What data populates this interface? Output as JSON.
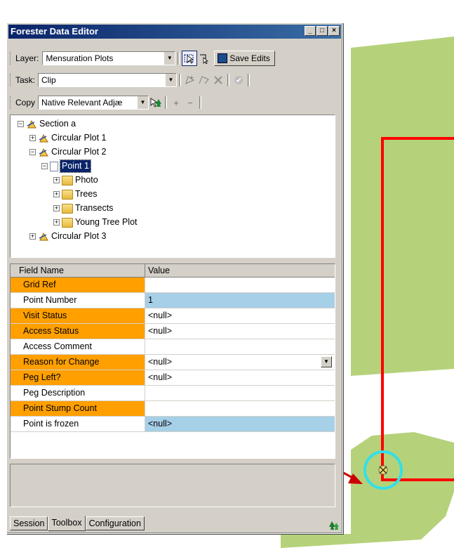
{
  "window": {
    "title": "Forester Data Editor",
    "buttons": [
      "_",
      "□",
      "×"
    ]
  },
  "toolbar": {
    "layer_label": "Layer:",
    "layer_value": "Mensuration Plots",
    "save_label": "Save Edits",
    "task_label": "Task:",
    "task_value": "Clip",
    "copy_label": "Copy",
    "copy_value": "Native Relevant Adjæ",
    "plus_label": "+",
    "minus_label": "−"
  },
  "tree": {
    "nodes": [
      {
        "label": "Section a",
        "toggle": "−",
        "icon": "plot-icon"
      },
      {
        "label": "Circular Plot 1",
        "toggle": "+",
        "icon": "plot-icon"
      },
      {
        "label": "Circular Plot 2",
        "toggle": "−",
        "icon": "plot-icon"
      },
      {
        "label": "Point 1",
        "toggle": "−",
        "icon": "document-icon",
        "selected": true
      },
      {
        "label": "Photo",
        "toggle": "+",
        "icon": "folder-icon"
      },
      {
        "label": "Trees",
        "toggle": "+",
        "icon": "folder-icon"
      },
      {
        "label": "Transects",
        "toggle": "+",
        "icon": "folder-icon"
      },
      {
        "label": "Young Tree Plot",
        "toggle": "+",
        "icon": "folder-icon"
      },
      {
        "label": "Circular Plot 3",
        "toggle": "+",
        "icon": "plot-icon"
      }
    ]
  },
  "grid": {
    "headers": [
      "Field Name",
      "Value"
    ],
    "rows": [
      {
        "name": "Grid Ref",
        "value": "",
        "required": true
      },
      {
        "name": "Point Number",
        "value": "1",
        "required": false,
        "highlight": true
      },
      {
        "name": "Visit Status",
        "value": "<null>",
        "required": true
      },
      {
        "name": "Access Status",
        "value": "<null>",
        "required": true
      },
      {
        "name": "Access Comment",
        "value": "",
        "required": false
      },
      {
        "name": "Reason for Change",
        "value": "<null>",
        "required": true,
        "dropdown": true
      },
      {
        "name": "Peg Left?",
        "value": "<null>",
        "required": true
      },
      {
        "name": "Peg Description",
        "value": "",
        "required": false
      },
      {
        "name": "Point Stump Count",
        "value": "",
        "required": true
      },
      {
        "name": "Point is frozen",
        "value": "<null>",
        "required": false,
        "highlight": true
      }
    ]
  },
  "tabs": [
    "Session",
    "Toolbox",
    "Configuration"
  ],
  "active_tab": "Toolbox",
  "colors": {
    "required_field": "#ff9f00",
    "highlight_value": "#a6cfe8",
    "map_polygon": "#b5d27a",
    "boundary_line": "#ff0000",
    "point_circle": "#33e0e8"
  }
}
